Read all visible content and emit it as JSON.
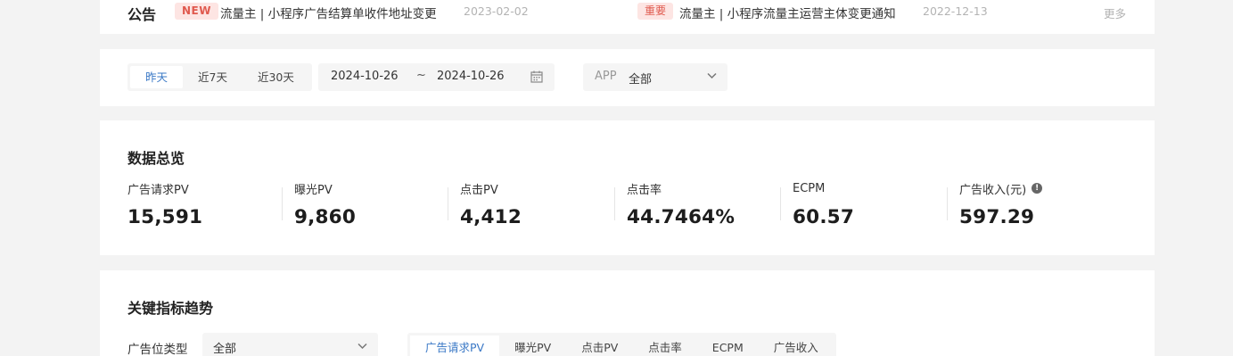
{
  "notice": {
    "title": "公告",
    "items": [
      {
        "badge": "NEW",
        "text": "流量主 | 小程序广告结算单收件地址变更",
        "date": "2023-02-02"
      },
      {
        "badge": "重要",
        "text": "流量主 | 小程序流量主运营主体变更通知",
        "date": "2022-12-13"
      }
    ],
    "more": "更多"
  },
  "filter": {
    "ranges": [
      "昨天",
      "近7天",
      "近30天"
    ],
    "active_range": "昨天",
    "date_start": "2024-10-26",
    "date_sep": "~",
    "date_end": "2024-10-26",
    "app_label": "APP",
    "app_value": "全部"
  },
  "overview": {
    "title": "数据总览",
    "metrics": [
      {
        "label": "广告请求PV",
        "value": "15,591"
      },
      {
        "label": "曝光PV",
        "value": "9,860"
      },
      {
        "label": "点击PV",
        "value": "4,412"
      },
      {
        "label": "点击率",
        "value": "44.7464%"
      },
      {
        "label": "ECPM",
        "value": "60.57"
      },
      {
        "label": "广告收入(元)",
        "value": "597.29",
        "info_icon": "info-circle-icon"
      }
    ]
  },
  "trend": {
    "title": "关键指标趋势",
    "type_label": "广告位类型",
    "type_value": "全部",
    "tabs": [
      "广告请求PV",
      "曝光PV",
      "点击PV",
      "点击率",
      "ECPM",
      "广告收入"
    ],
    "active_tab": "广告请求PV"
  },
  "colors": {
    "accent": "#3a78c6",
    "badge_bg": "#fde5e3",
    "badge_text": "#e05a4f",
    "page_bg": "#f3f3f3"
  }
}
